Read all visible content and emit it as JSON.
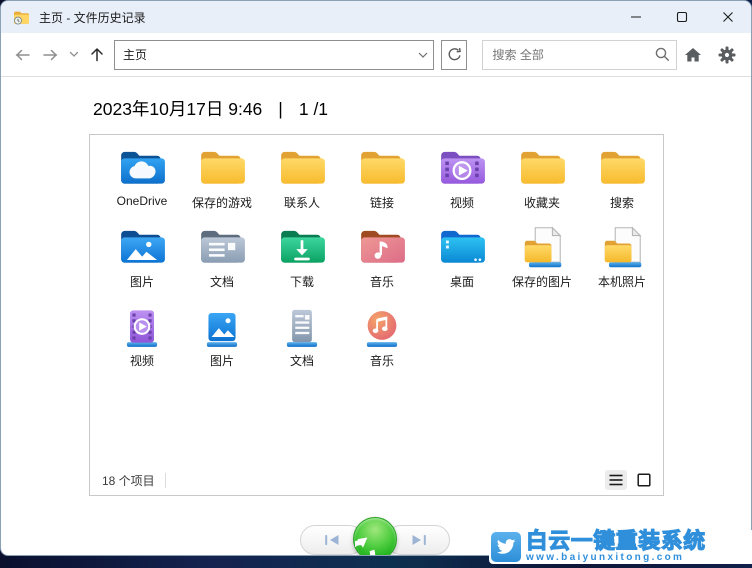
{
  "titlebar": {
    "title": "主页 - 文件历史记录"
  },
  "toolbar": {
    "address_value": "主页",
    "search_placeholder": "搜索 全部"
  },
  "heading": {
    "date": "2023年10月17日 9:46",
    "divider": "|",
    "page": "1 /1"
  },
  "panel": {
    "status": "18 个项目",
    "items": [
      {
        "label": "OneDrive",
        "icon": "onedrive-folder"
      },
      {
        "label": "保存的游戏",
        "icon": "yellow-folder"
      },
      {
        "label": "联系人",
        "icon": "yellow-folder"
      },
      {
        "label": "链接",
        "icon": "yellow-folder"
      },
      {
        "label": "视频",
        "icon": "videos-folder"
      },
      {
        "label": "收藏夹",
        "icon": "yellow-folder"
      },
      {
        "label": "搜索",
        "icon": "yellow-folder"
      },
      {
        "label": "图片",
        "icon": "pictures-folder"
      },
      {
        "label": "文档",
        "icon": "documents-folder"
      },
      {
        "label": "下载",
        "icon": "downloads-folder"
      },
      {
        "label": "音乐",
        "icon": "music-folder"
      },
      {
        "label": "桌面",
        "icon": "desktop-folder"
      },
      {
        "label": "保存的图片",
        "icon": "saved-pictures-folder"
      },
      {
        "label": "本机照片",
        "icon": "camera-roll-folder"
      },
      {
        "label": "视频",
        "icon": "videos-library"
      },
      {
        "label": "图片",
        "icon": "pictures-library"
      },
      {
        "label": "文档",
        "icon": "documents-library"
      },
      {
        "label": "音乐",
        "icon": "music-library"
      }
    ]
  },
  "watermark": {
    "title": "白云一键重装系统",
    "url": "www.baiyunxitong.com"
  },
  "colors": {
    "titlebar_bg": "#e8eff9",
    "restore_green": "#22b41f",
    "watermark_blue": "#2f8fdb",
    "folder_yellow": "#f7bb2e",
    "desktop_bg": "#0d1638"
  }
}
